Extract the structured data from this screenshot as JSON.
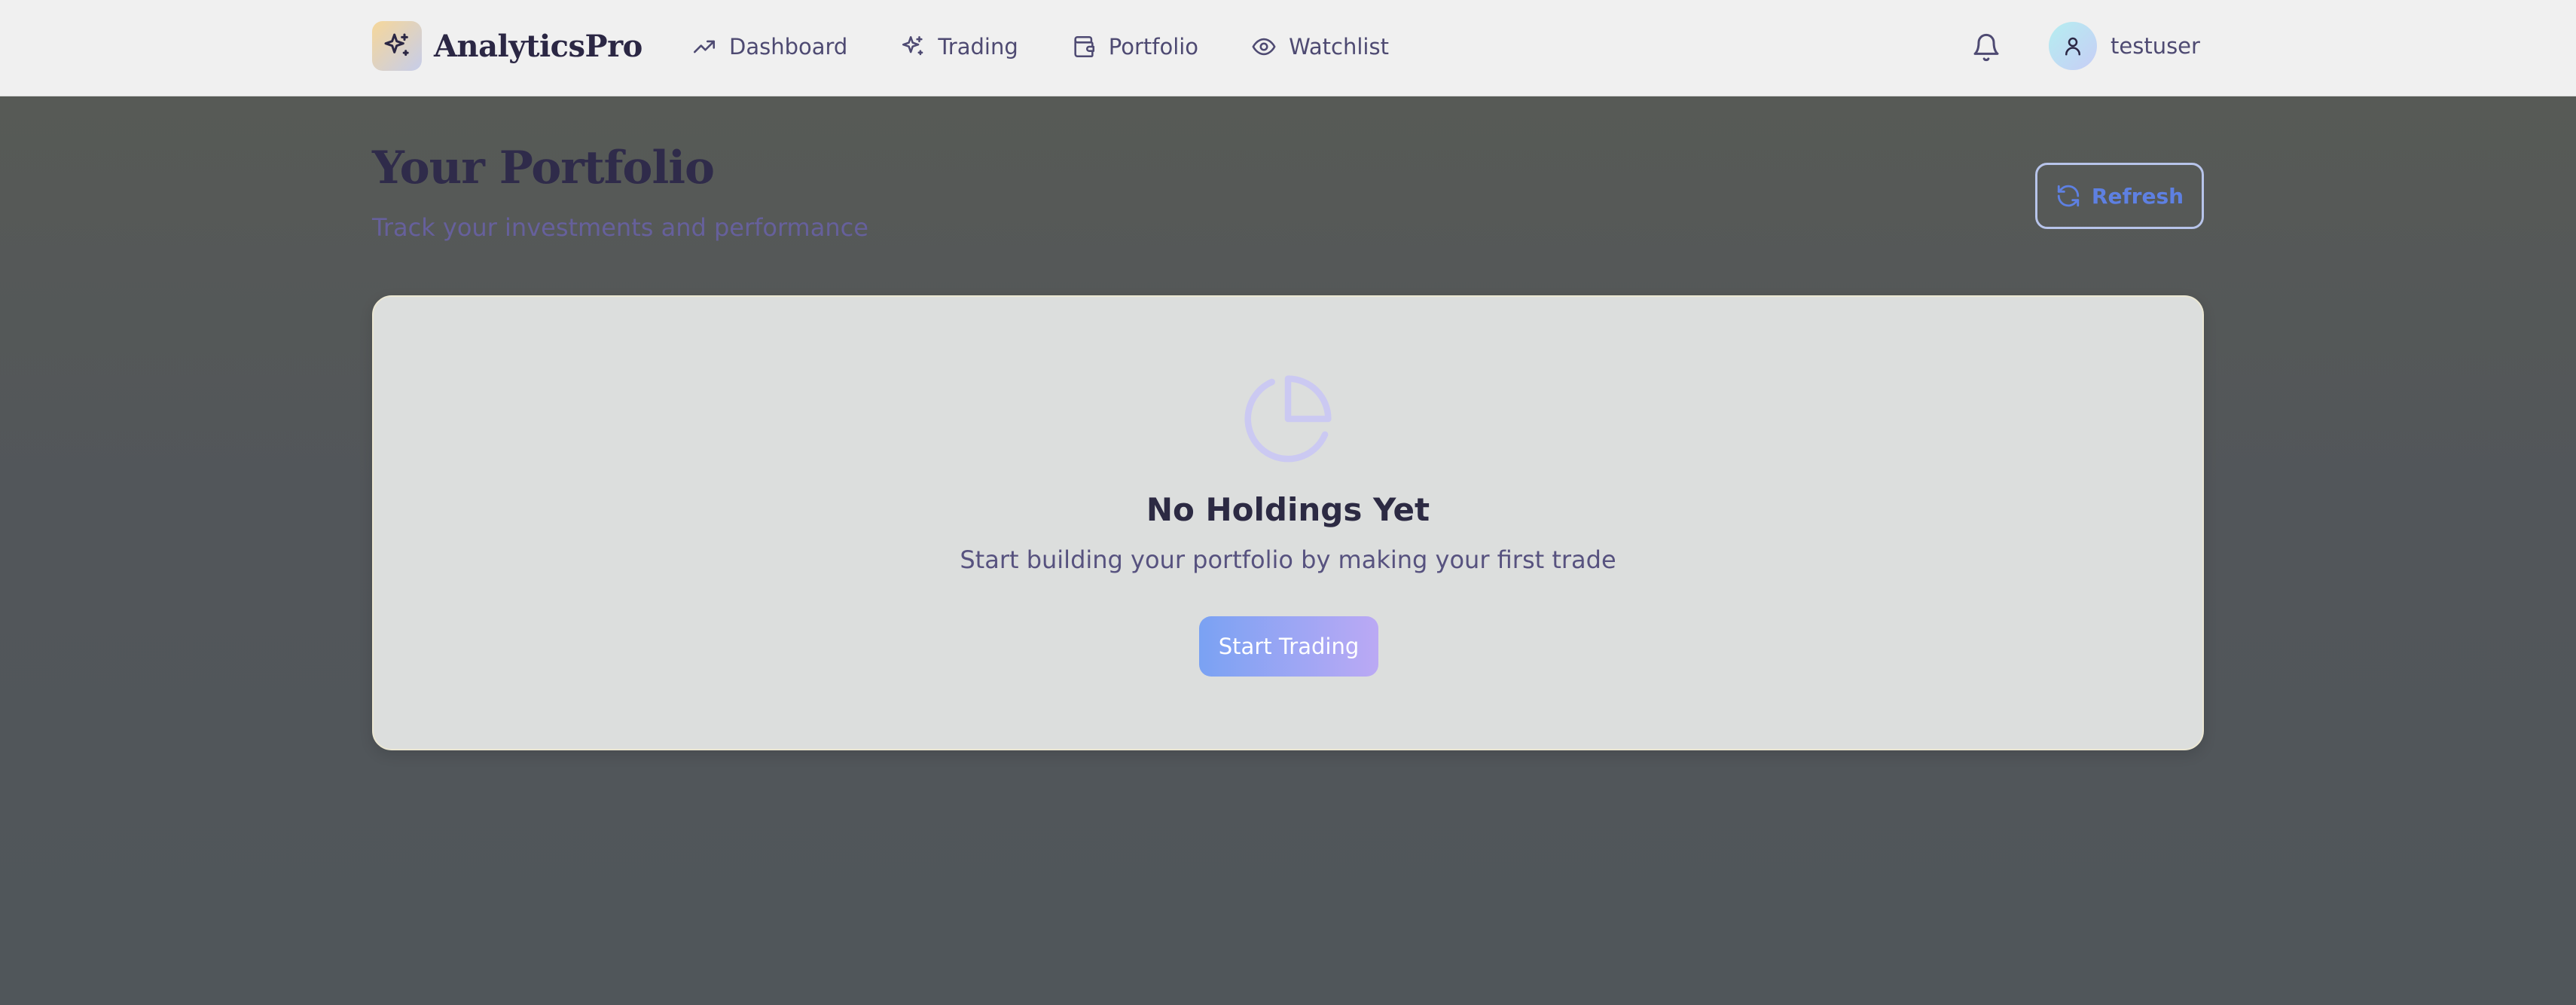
{
  "brand": {
    "name": "AnalyticsPro",
    "logo_icon": "sparkles-icon"
  },
  "nav": {
    "items": [
      {
        "label": "Dashboard",
        "icon": "trending-up-icon"
      },
      {
        "label": "Trading",
        "icon": "sparkles-icon"
      },
      {
        "label": "Portfolio",
        "icon": "wallet-icon"
      },
      {
        "label": "Watchlist",
        "icon": "eye-icon"
      }
    ]
  },
  "header": {
    "notifications_icon": "bell-icon",
    "username": "testuser",
    "avatar_icon": "user-icon"
  },
  "page": {
    "title": "Your Portfolio",
    "subtitle": "Track your investments and performance",
    "refresh_label": "Refresh"
  },
  "empty_state": {
    "icon": "pie-chart-icon",
    "title": "No Holdings Yet",
    "message": "Start building your portfolio by making your first trade",
    "cta_label": "Start Trading"
  },
  "colors": {
    "accent": "#5e80e2",
    "cta_gradient_start": "#7aa2f3",
    "cta_gradient_end": "#bba9f4",
    "text_primary": "#2c2a43",
    "text_muted": "#57527f"
  }
}
